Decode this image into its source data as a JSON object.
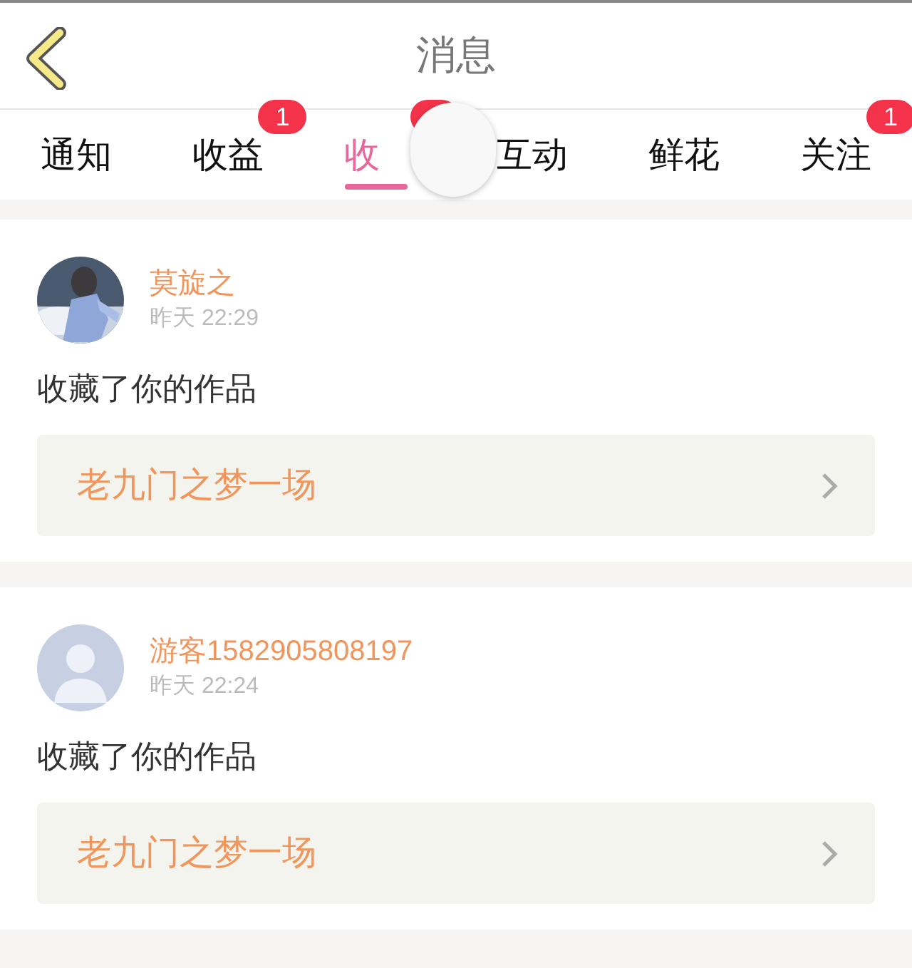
{
  "header": {
    "title": "消息"
  },
  "tabs": [
    {
      "label": "通知",
      "selected": false,
      "badge": false
    },
    {
      "label": "收益",
      "selected": false,
      "badge": true,
      "count": "1"
    },
    {
      "label": "收",
      "selected": true,
      "badge": true
    },
    {
      "label": "互动",
      "selected": false,
      "badge": false
    },
    {
      "label": "鲜花",
      "selected": false,
      "badge": false
    },
    {
      "label": "关注",
      "selected": false,
      "badge": true,
      "count": "1"
    }
  ],
  "messages": [
    {
      "kind": "picture",
      "name": "莫旋之",
      "time": "昨天 22:29",
      "text": "收藏了你的作品",
      "work": "老九门之梦一场"
    },
    {
      "kind": "default",
      "name": "游客1582905808197",
      "time": "昨天 22:24",
      "text": "收藏了你的作品",
      "work": "老九门之梦一场"
    }
  ]
}
